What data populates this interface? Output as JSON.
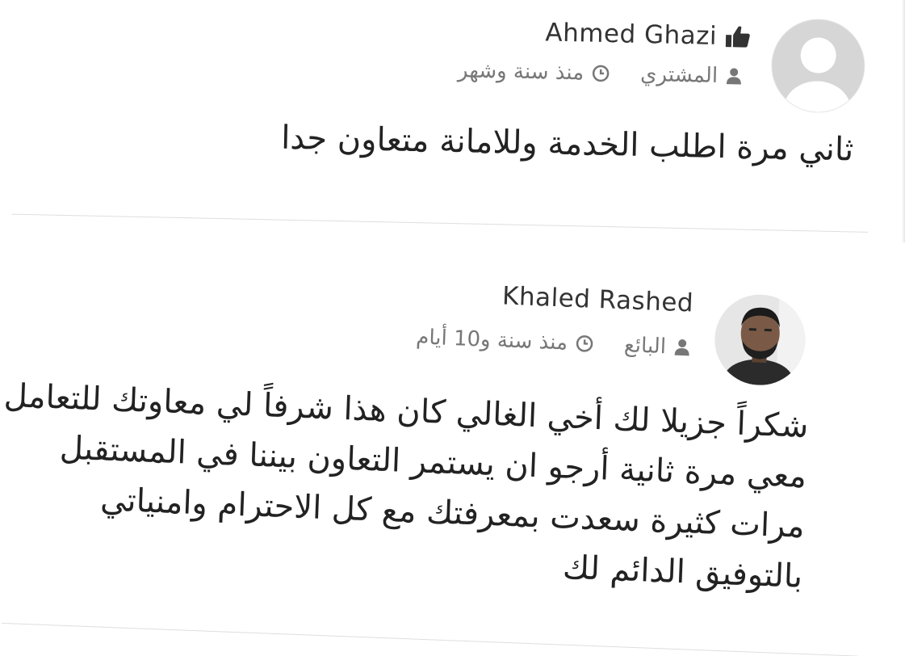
{
  "reviews": [
    {
      "reviewer_name": "Ahmed Ghazi",
      "badge_icon": "thumbs-up-icon",
      "role_icon": "user-icon",
      "role": "المشتري",
      "time_icon": "clock-icon",
      "time": "منذ سنة وشهر",
      "comment": "ثاني مرة اطلب الخدمة وللامانة متعاون جدا"
    },
    {
      "reviewer_name": "Khaled Rashed",
      "role_icon": "user-icon",
      "role": "البائع",
      "time_icon": "clock-icon",
      "time": "منذ سنة و10 أيام",
      "comment_lines": [
        "شكراً جزيلا لك أخي الغالي كان هذا شرفاً لي معاوتك للتعامل",
        "معي مرة ثانية أرجو ان يستمر التعاون بيننا في المستقبل",
        "مرات كثيرة سعدت بمعرفتك مع كل الاحترام وامنياتي",
        "بالتوفيق الدائم لك"
      ]
    }
  ],
  "colors": {
    "name": "#333333",
    "meta": "#777777",
    "comment": "#222222",
    "divider": "#dedede",
    "avatar_default_bg": "#d6d6d6"
  }
}
